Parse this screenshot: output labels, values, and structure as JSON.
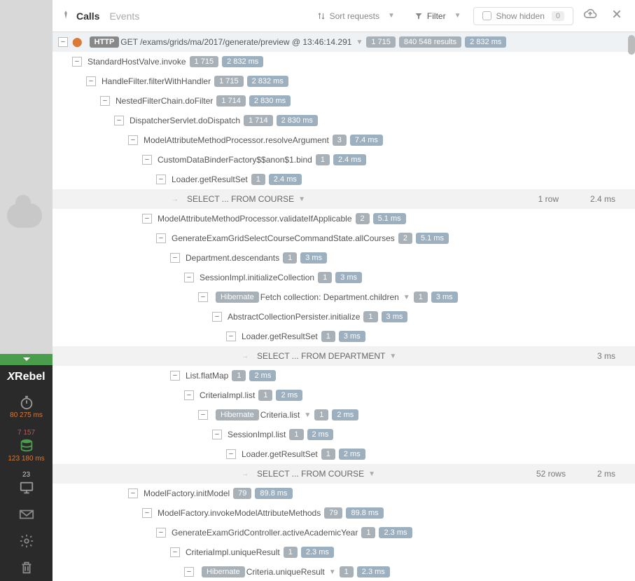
{
  "sidebar": {
    "logo": "XRebel",
    "timer_val": "80 275 ms",
    "db_count": "7 157",
    "db_time": "123 180 ms",
    "io_count": "23"
  },
  "toolbar": {
    "tabs": {
      "calls": "Calls",
      "events": "Events"
    },
    "sort": "Sort requests",
    "filter": "Filter",
    "show_hidden": "Show hidden",
    "hidden_count": "0"
  },
  "tree": {
    "r0": {
      "http": "HTTP",
      "text": "GET /exams/grids/ma/2017/generate/preview @ 13:46:14.291",
      "b1": "1 715",
      "b2": "840 548 results",
      "b3": "2 832 ms"
    },
    "r1": {
      "text": "StandardHostValve.invoke",
      "b1": "1 715",
      "b2": "2 832 ms"
    },
    "r2": {
      "text": "HandleFilter.filterWithHandler",
      "b1": "1 715",
      "b2": "2 832 ms"
    },
    "r3": {
      "text": "NestedFilterChain.doFilter",
      "b1": "1 714",
      "b2": "2 830 ms"
    },
    "r4": {
      "text": "DispatcherServlet.doDispatch",
      "b1": "1 714",
      "b2": "2 830 ms"
    },
    "r5": {
      "text": "ModelAttributeMethodProcessor.resolveArgument",
      "b1": "3",
      "b2": "7.4 ms"
    },
    "r6": {
      "text": "CustomDataBinderFactory$$anon$1.bind",
      "b1": "1",
      "b2": "2.4 ms"
    },
    "r7": {
      "text": "Loader.getResultSet",
      "b1": "1",
      "b2": "2.4 ms"
    },
    "r8": {
      "text": "SELECT ... FROM COURSE",
      "right1": "1 row",
      "right2": "2.4 ms"
    },
    "r9": {
      "text": "ModelAttributeMethodProcessor.validateIfApplicable",
      "b1": "2",
      "b2": "5.1 ms"
    },
    "r10": {
      "text": "GenerateExamGridSelectCourseCommandState.allCourses",
      "b1": "2",
      "b2": "5.1 ms"
    },
    "r11": {
      "text": "Department.descendants",
      "b1": "1",
      "b2": "3 ms"
    },
    "r12": {
      "text": "SessionImpl.initializeCollection",
      "b1": "1",
      "b2": "3 ms"
    },
    "r13": {
      "tag": "Hibernate",
      "text": "Fetch collection: Department.children",
      "b1": "1",
      "b2": "3 ms"
    },
    "r14": {
      "text": "AbstractCollectionPersister.initialize",
      "b1": "1",
      "b2": "3 ms"
    },
    "r15": {
      "text": "Loader.getResultSet",
      "b1": "1",
      "b2": "3 ms"
    },
    "r16": {
      "text": "SELECT ... FROM DEPARTMENT",
      "right2": "3 ms"
    },
    "r17": {
      "text": "List.flatMap",
      "b1": "1",
      "b2": "2 ms"
    },
    "r18": {
      "text": "CriteriaImpl.list",
      "b1": "1",
      "b2": "2 ms"
    },
    "r19": {
      "tag": "Hibernate",
      "text": "Criteria.list",
      "b1": "1",
      "b2": "2 ms"
    },
    "r20": {
      "text": "SessionImpl.list",
      "b1": "1",
      "b2": "2 ms"
    },
    "r21": {
      "text": "Loader.getResultSet",
      "b1": "1",
      "b2": "2 ms"
    },
    "r22": {
      "text": "SELECT ... FROM COURSE",
      "right1": "52 rows",
      "right2": "2 ms"
    },
    "r23": {
      "text": "ModelFactory.initModel",
      "b1": "79",
      "b2": "89.8 ms"
    },
    "r24": {
      "text": "ModelFactory.invokeModelAttributeMethods",
      "b1": "79",
      "b2": "89.8 ms"
    },
    "r25": {
      "text": "GenerateExamGridController.activeAcademicYear",
      "b1": "1",
      "b2": "2.3 ms"
    },
    "r26": {
      "text": "CriteriaImpl.uniqueResult",
      "b1": "1",
      "b2": "2.3 ms"
    },
    "r27": {
      "tag": "Hibernate",
      "text": "Criteria.uniqueResult",
      "b1": "1",
      "b2": "2.3 ms"
    }
  }
}
